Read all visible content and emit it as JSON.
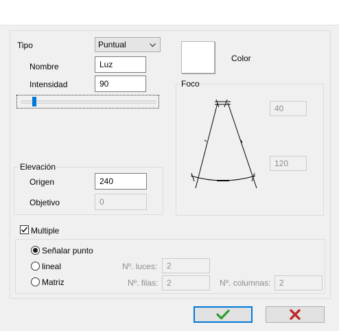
{
  "tipo": {
    "label": "Tipo",
    "value": "Puntual"
  },
  "nombre": {
    "label": "Nombre",
    "value": "Luz"
  },
  "intensidad": {
    "label": "Intensidad",
    "value": "90"
  },
  "color": {
    "label": "Color",
    "swatch": "#ffffff"
  },
  "foco": {
    "label": "Foco",
    "angle_top": "40",
    "angle_bottom": "120"
  },
  "elevacion": {
    "label": "Elevación",
    "origen_label": "Origen",
    "origen_value": "240",
    "objetivo_label": "Objetivo",
    "objetivo_value": "0"
  },
  "multiple": {
    "label": "Multiple",
    "checked": true
  },
  "modes": {
    "senalar": "Señalar punto",
    "lineal": "lineal",
    "matriz": "Matriz",
    "selected": "senalar"
  },
  "luces": {
    "label": "Nº. luces:",
    "value": "2"
  },
  "filas": {
    "label": "Nº. filas:",
    "value": "2"
  },
  "columnas": {
    "label": "Nº. columnas:",
    "value": "2"
  },
  "colors": {
    "ok": "#2e9d2e",
    "cancel": "#c0282a",
    "focus": "#0078d7"
  }
}
